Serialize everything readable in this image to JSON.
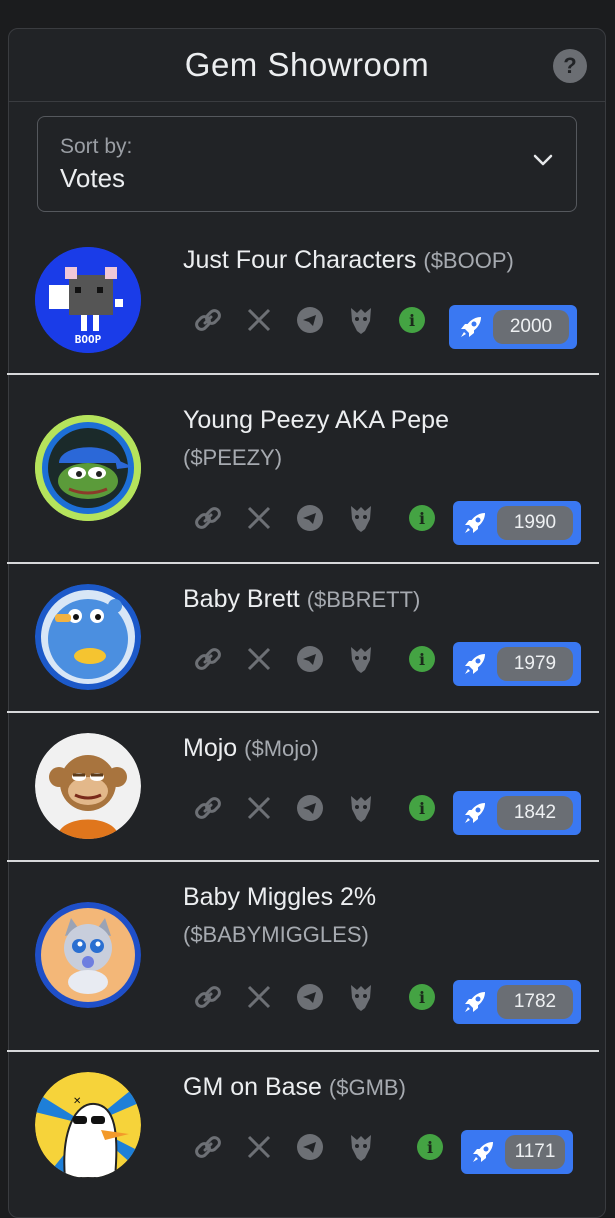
{
  "header": {
    "title": "Gem Showroom"
  },
  "sort": {
    "label": "Sort by:",
    "value": "Votes"
  },
  "tokens": [
    {
      "name": "Just Four Characters",
      "ticker": "($BOOP)",
      "votes": "2000"
    },
    {
      "name": "Young Peezy AKA Pepe",
      "ticker": "($PEEZY)",
      "votes": "1990"
    },
    {
      "name": "Baby Brett",
      "ticker": "($BBRETT)",
      "votes": "1979"
    },
    {
      "name": "Mojo",
      "ticker": "($Mojo)",
      "votes": "1842"
    },
    {
      "name": "Baby Miggles 2%",
      "ticker": "($BABYMIGGLES)",
      "votes": "1782"
    },
    {
      "name": "GM on Base",
      "ticker": "($GMB)",
      "votes": "1171"
    }
  ],
  "icons": [
    "link-icon",
    "x-icon",
    "telegram-icon",
    "eagle-icon",
    "info-icon",
    "rocket-icon",
    "help-icon",
    "chevron-down-icon"
  ],
  "colors": {
    "accent": "#3a78f2",
    "info": "#44a343",
    "background": "#212326"
  }
}
